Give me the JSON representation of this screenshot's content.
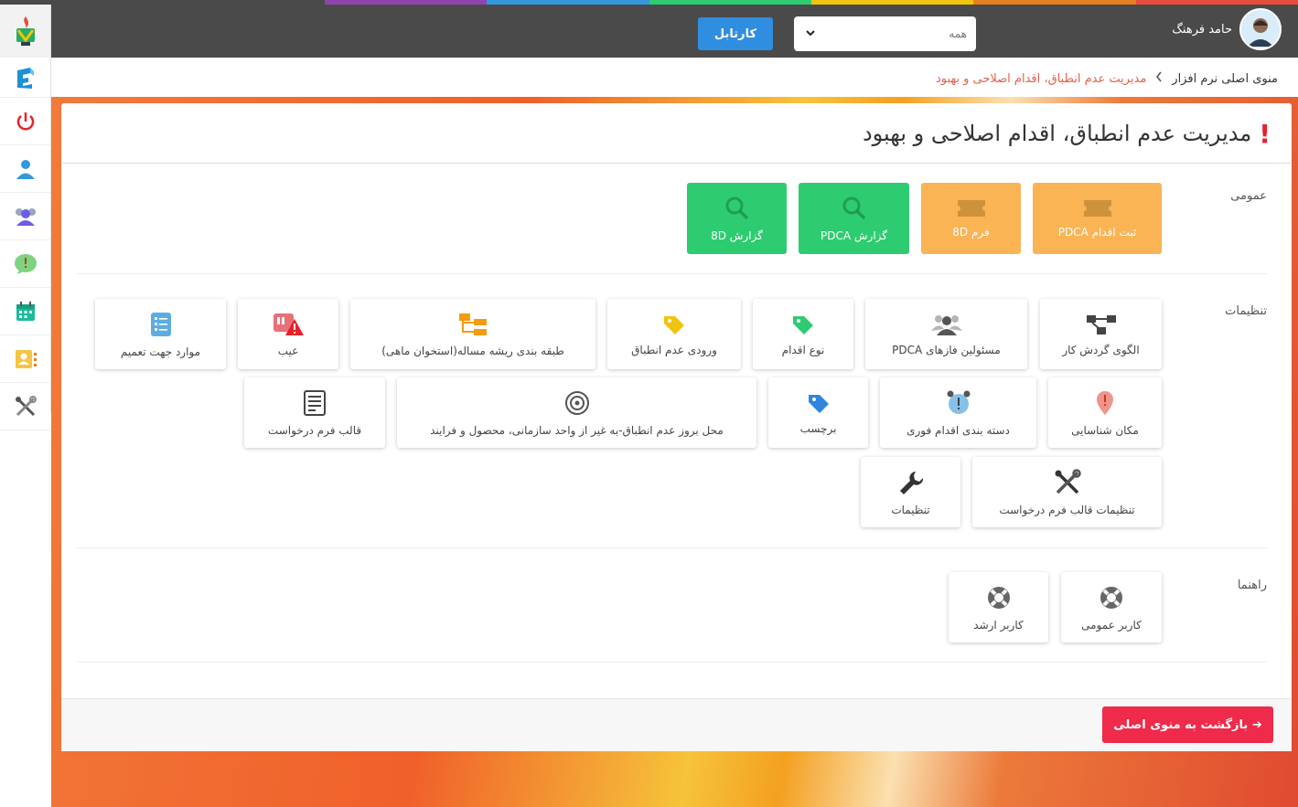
{
  "topbar": {
    "user_name": "حامد فرهنگ",
    "filter_value": "همه",
    "cartable_label": "کارتابل"
  },
  "breadcrumb": {
    "home": "منوی اصلی نرم افزار",
    "current": "مدیریت عدم انطباق، اقدام اصلاحی و بهبود"
  },
  "page": {
    "title": "مدیریت عدم انطباق، اقدام اصلاحی و بهبود",
    "back_label": "بازگشت به منوی اصلی"
  },
  "sections": {
    "general": {
      "label": "عمومی",
      "tiles": [
        "ثبت اقدام PDCA",
        "فرم 8D",
        "گزارش PDCA",
        "گزارش 8D"
      ]
    },
    "settings": {
      "label": "تنظیمات",
      "tiles": [
        "الگوی گردش کار",
        "مسئولین فازهای PDCA",
        "نوع اقدام",
        "ورودی عدم انطباق",
        "طبقه بندی ریشه مساله(استخوان ماهی)",
        "عیب",
        "موارد جهت تعمیم",
        "مکان شناسایی",
        "دسته بندی اقدام فوری",
        "برچسب",
        "محل بروز عدم انطباق-به غیر از واحد سازمانی، محصول و فرایند",
        "قالب فرم درخواست",
        "تنظیمات قالب فرم درخواست",
        "تنظیمات"
      ]
    },
    "guide": {
      "label": "راهنما",
      "tiles": [
        "کاربر عمومی",
        "کاربر ارشد"
      ]
    }
  },
  "colors": {
    "green": "#2ecc71",
    "orange": "#fbb454",
    "back_button": "#ef2a4b",
    "cartable": "#2f8ee0"
  }
}
